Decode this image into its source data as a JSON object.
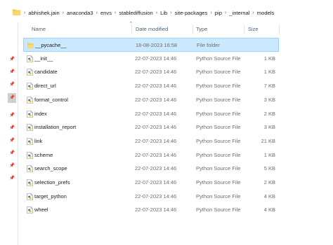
{
  "breadcrumb": [
    "abhishek.jain",
    "anaconda3",
    "envs",
    "stablediffusion",
    "Lib",
    "site-packages",
    "pip",
    "_internal",
    "models"
  ],
  "columns": {
    "name": "Name",
    "date": "Date modified",
    "type": "Type",
    "size": "Size"
  },
  "files": [
    {
      "name": "__pycache__",
      "date": "18-08-2023 16:58",
      "type": "File folder",
      "size": "",
      "kind": "folder",
      "selected": true
    },
    {
      "name": "__init__",
      "date": "22-07-2023 14:46",
      "type": "Python Source File",
      "size": "1 KB",
      "kind": "python"
    },
    {
      "name": "candidate",
      "date": "22-07-2023 14:46",
      "type": "Python Source File",
      "size": "1 KB",
      "kind": "python"
    },
    {
      "name": "direct_url",
      "date": "22-07-2023 14:46",
      "type": "Python Source File",
      "size": "7 KB",
      "kind": "python"
    },
    {
      "name": "format_control",
      "date": "22-07-2023 14:46",
      "type": "Python Source File",
      "size": "3 KB",
      "kind": "python"
    },
    {
      "name": "index",
      "date": "22-07-2023 14:46",
      "type": "Python Source File",
      "size": "2 KB",
      "kind": "python"
    },
    {
      "name": "installation_report",
      "date": "22-07-2023 14:46",
      "type": "Python Source File",
      "size": "3 KB",
      "kind": "python"
    },
    {
      "name": "link",
      "date": "22-07-2023 14:46",
      "type": "Python Source File",
      "size": "21 KB",
      "kind": "python"
    },
    {
      "name": "scheme",
      "date": "22-07-2023 14:46",
      "type": "Python Source File",
      "size": "1 KB",
      "kind": "python"
    },
    {
      "name": "search_scope",
      "date": "22-07-2023 14:46",
      "type": "Python Source File",
      "size": "5 KB",
      "kind": "python"
    },
    {
      "name": "selection_prefs",
      "date": "22-07-2023 14:46",
      "type": "Python Source File",
      "size": "2 KB",
      "kind": "python"
    },
    {
      "name": "target_python",
      "date": "22-07-2023 14:46",
      "type": "Python Source File",
      "size": "4 KB",
      "kind": "python"
    },
    {
      "name": "wheel",
      "date": "22-07-2023 14:46",
      "type": "Python Source File",
      "size": "4 KB",
      "kind": "python"
    }
  ],
  "colors": {
    "selected_bg": "#cce8ff",
    "selected_border": "#99d1ff",
    "folder": "#f2c94c",
    "python_blue": "#3b73b9",
    "python_yellow": "#f5c400"
  },
  "icons": {
    "folder": "folder-icon",
    "python": "python-file-icon",
    "pin": "pin-icon"
  }
}
